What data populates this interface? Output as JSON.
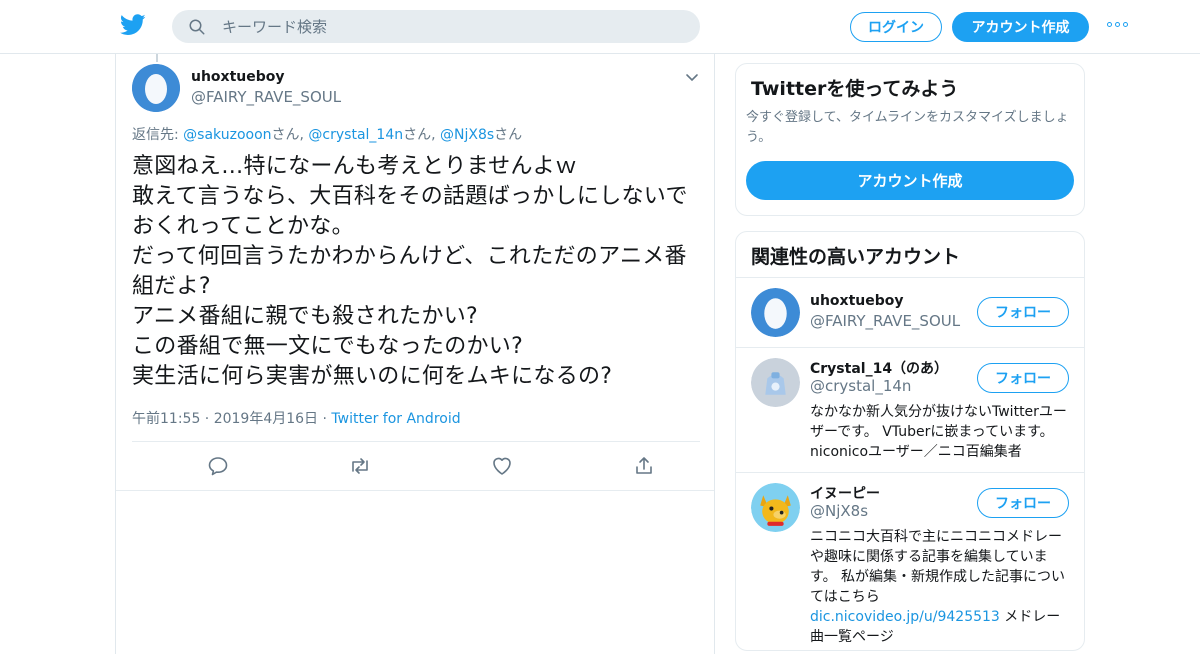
{
  "header": {
    "search_placeholder": "キーワード検索",
    "login_label": "ログイン",
    "signup_label": "アカウント作成",
    "brand_color": "#1da1f2"
  },
  "tweet": {
    "author_name": "uhoxtueboy",
    "author_handle": "@FAIRY_RAVE_SOUL",
    "reply_prefix": "返信先: ",
    "reply_mentions": [
      {
        "mention": "@sakuzooon",
        "suffix": "さん, "
      },
      {
        "mention": "@crystal_14n",
        "suffix": "さん, "
      },
      {
        "mention": "@NjX8s",
        "suffix": "さん"
      }
    ],
    "text": "意図ねえ…特になーんも考えとりませんよｗ\n敢えて言うなら、大百科をその話題ばっかしにしないでおくれってことかな。\nだって何回言うたかわからんけど、これただのアニメ番組だよ?\nアニメ番組に親でも殺されたかい?\nこの番組で無一文にでもなったのかい?\n実生活に何ら実害が無いのに何をムキになるの?",
    "timestamp": "午前11:55 · 2019年4月16日",
    "separator": " · ",
    "source": "Twitter for Android",
    "actions": [
      "reply-icon",
      "retweet-icon",
      "like-icon",
      "share-icon"
    ]
  },
  "signup_card": {
    "title": "Twitterを使ってみよう",
    "description": "今すぐ登録して、タイムラインをカスタマイズしましょう。",
    "button_label": "アカウント作成"
  },
  "related": {
    "title": "関連性の高いアカウント",
    "follow_label": "フォロー",
    "accounts": [
      {
        "name": "uhoxtueboy",
        "handle": "@FAIRY_RAVE_SOUL",
        "bio": ""
      },
      {
        "name": "Crystal_14（のあ）",
        "handle": "@crystal_14n",
        "bio": "なかなか新人気分が抜けないTwitterユーザーです。 VTuberに嵌まっています。 niconicoユーザー／ニコ百編集者"
      },
      {
        "name": "イヌーピー",
        "handle": "@NjX8s",
        "bio": "ニコニコ大百科で主にニコニコメドレーや趣味に関係する記事を編集しています。 私が編集・新規作成した記事についてはこちら",
        "bio_link": "dic.nicovideo.jp/u/9425513",
        "bio_after": " メドレー曲一覧ページ"
      }
    ]
  }
}
